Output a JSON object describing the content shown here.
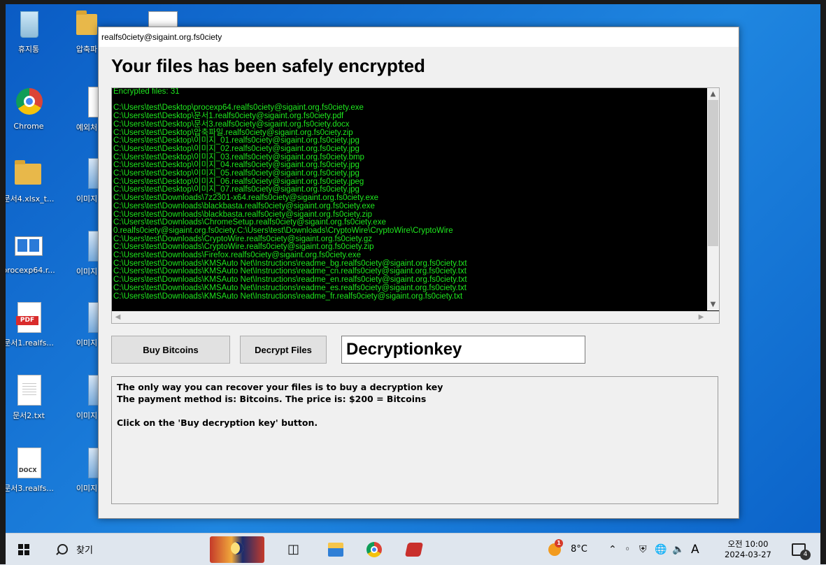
{
  "desktop": {
    "icons": [
      {
        "label": "휴지통",
        "icon": "recycle-bin-icon"
      },
      {
        "label": "Chrome",
        "icon": "chrome-icon"
      },
      {
        "label": "문서4.xlsx_t...",
        "icon": "folder-icon"
      },
      {
        "label": "procexp64.r...",
        "icon": "window-app-icon"
      },
      {
        "label": "문서1.realfs...",
        "icon": "pdf-icon"
      },
      {
        "label": "문서2.txt",
        "icon": "text-file-icon"
      },
      {
        "label": "문서3.realfs...",
        "icon": "docx-icon"
      }
    ],
    "second_column": [
      {
        "label": "압축파",
        "icon": "zip-folder-icon"
      },
      {
        "label": "예외처",
        "icon": "text-file-icon"
      },
      {
        "label": "이미지",
        "icon": "image-file-icon"
      },
      {
        "label": "이미지",
        "icon": "image-file-icon"
      },
      {
        "label": "이미지",
        "icon": "image-file-icon"
      },
      {
        "label": "이미지",
        "icon": "image-file-icon"
      },
      {
        "label": "이미지",
        "icon": "image-file-icon"
      }
    ]
  },
  "window": {
    "title": "realfs0ciety@sigaint.org.fs0ciety",
    "heading": "Your files has been safely encrypted",
    "log_lines": [
      "Encrypted files: 31",
      "",
      "C:\\Users\\test\\Desktop\\procexp64.realfs0ciety@sigaint.org.fs0ciety.exe",
      "C:\\Users\\test\\Desktop\\문서1.realfs0ciety@sigaint.org.fs0ciety.pdf",
      "C:\\Users\\test\\Desktop\\문서3.realfs0ciety@sigaint.org.fs0ciety.docx",
      "C:\\Users\\test\\Desktop\\압축파일.realfs0ciety@sigaint.org.fs0ciety.zip",
      "C:\\Users\\test\\Desktop\\이미지_01.realfs0ciety@sigaint.org.fs0ciety.jpg",
      "C:\\Users\\test\\Desktop\\이미지_02.realfs0ciety@sigaint.org.fs0ciety.jpg",
      "C:\\Users\\test\\Desktop\\이미지_03.realfs0ciety@sigaint.org.fs0ciety.bmp",
      "C:\\Users\\test\\Desktop\\이미지_04.realfs0ciety@sigaint.org.fs0ciety.jpg",
      "C:\\Users\\test\\Desktop\\이미지_05.realfs0ciety@sigaint.org.fs0ciety.jpg",
      "C:\\Users\\test\\Desktop\\이미지_06.realfs0ciety@sigaint.org.fs0ciety.jpeg",
      "C:\\Users\\test\\Desktop\\이미지_07.realfs0ciety@sigaint.org.fs0ciety.jpg",
      "C:\\Users\\test\\Downloads\\7z2301-x64.realfs0ciety@sigaint.org.fs0ciety.exe",
      "C:\\Users\\test\\Downloads\\blackbasta.realfs0ciety@sigaint.org.fs0ciety.exe",
      "C:\\Users\\test\\Downloads\\blackbasta.realfs0ciety@sigaint.org.fs0ciety.zip",
      "C:\\Users\\test\\Downloads\\ChromeSetup.realfs0ciety@sigaint.org.fs0ciety.exe",
      "0.realfs0ciety@sigaint.org.fs0ciety.C:\\Users\\test\\Downloads\\CryptoWire\\CryptoWire\\CryptoWire",
      "C:\\Users\\test\\Downloads\\CryptoWire.realfs0ciety@sigaint.org.fs0ciety.gz",
      "C:\\Users\\test\\Downloads\\CryptoWire.realfs0ciety@sigaint.org.fs0ciety.zip",
      "C:\\Users\\test\\Downloads\\Firefox.realfs0ciety@sigaint.org.fs0ciety.exe",
      "C:\\Users\\test\\Downloads\\KMSAuto Net\\Instructions\\readme_bg.realfs0ciety@sigaint.org.fs0ciety.txt",
      "C:\\Users\\test\\Downloads\\KMSAuto Net\\Instructions\\readme_cn.realfs0ciety@sigaint.org.fs0ciety.txt",
      "C:\\Users\\test\\Downloads\\KMSAuto Net\\Instructions\\readme_en.realfs0ciety@sigaint.org.fs0ciety.txt",
      "C:\\Users\\test\\Downloads\\KMSAuto Net\\Instructions\\readme_es.realfs0ciety@sigaint.org.fs0ciety.txt",
      "C:\\Users\\test\\Downloads\\KMSAuto Net\\Instructions\\readme_fr.realfs0ciety@sigaint.org.fs0ciety.txt"
    ],
    "buy_button": "Buy Bitcoins",
    "decrypt_button": "Decrypt Files",
    "key_input_value": "Decryptionkey",
    "info_lines": [
      "The only way you can recover your files is to buy a decryption key",
      "The payment method is: Bitcoins.  The price is: $200 =  Bitcoins",
      "",
      "Click on the 'Buy decryption key' button."
    ]
  },
  "taskbar": {
    "search_label": "찾기",
    "weather": {
      "temperature": "8°C",
      "badge": "1"
    },
    "input_language": "A",
    "clock": {
      "time": "오전 10:00",
      "date": "2024-03-27"
    },
    "notification_count": "4"
  },
  "colors": {
    "log_text": "#1ee81e",
    "log_background": "#000000",
    "desktop": "#1f86e0"
  }
}
